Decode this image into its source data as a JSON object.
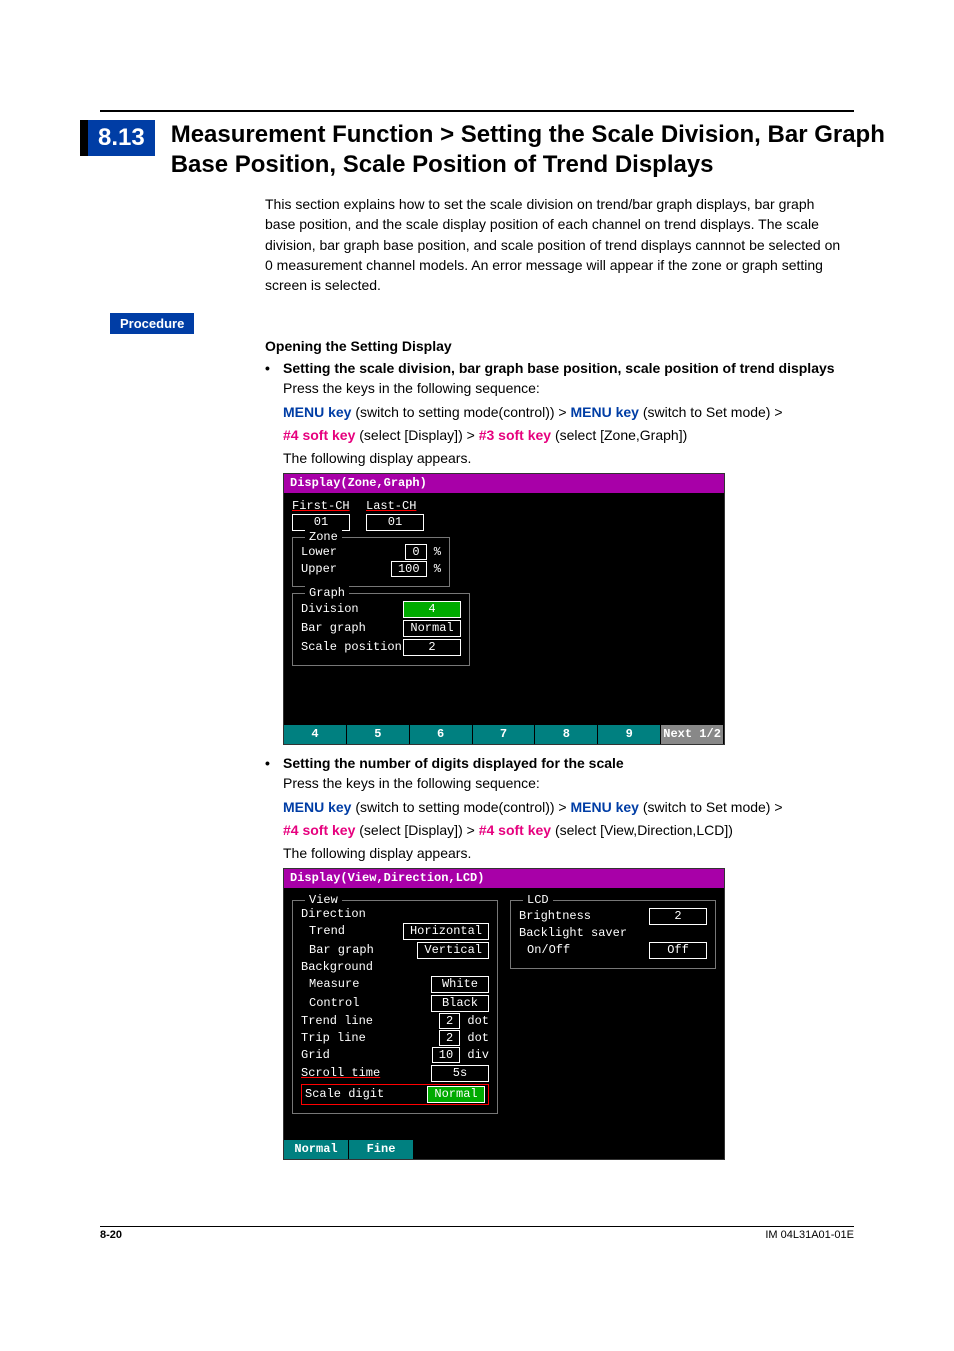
{
  "section_number": "8.13",
  "section_title": "Measurement Function > Setting the Scale Division, Bar Graph Base Position, Scale Position of Trend Displays",
  "intro": "This section explains how to set the scale division on trend/bar graph displays, bar graph base position, and the scale display position of each channel on trend displays. The scale division, bar graph base position, and scale position of trend displays cannnot be selected on 0 measurement channel models.  An error message will appear if the zone or graph setting screen is selected.",
  "procedure_label": "Procedure",
  "opening_heading": "Opening the Setting Display",
  "bullet1": "Setting the scale division, bar graph base position, scale position of trend displays",
  "press_keys": "Press the keys in the following sequence:",
  "key_menu": "MENU key",
  "key_menu_desc1": " (switch to setting mode(control)) > ",
  "key_menu_desc2": " (switch to Set mode) > ",
  "key_soft4": "#4 soft key",
  "key_soft4_desc1": " (select [Display]) > ",
  "key_soft3": "#3 soft key",
  "key_soft3_desc": " (select [Zone,Graph])",
  "following_display": "The following display appears.",
  "screen1": {
    "title": "Display(Zone,Graph)",
    "first_ch_label": "First-CH",
    "first_ch_val": "01",
    "last_ch_label": "Last-CH",
    "last_ch_val": "01",
    "zone_legend": "Zone",
    "lower_label": "Lower",
    "lower_val": "0",
    "lower_unit": "%",
    "upper_label": "Upper",
    "upper_val": "100",
    "upper_unit": "%",
    "graph_legend": "Graph",
    "division_label": "Division",
    "division_val": "4",
    "bargraph_label": "Bar graph",
    "bargraph_val": "Normal",
    "scalepos_label": "Scale position",
    "scalepos_val": "2",
    "softkeys": [
      "4",
      "5",
      "6",
      "7",
      "8",
      "9",
      "Next 1/2"
    ]
  },
  "bullet2": "Setting the number of digits displayed for the scale",
  "key_soft4_desc2": " (select [View,Direction,LCD])",
  "screen2": {
    "title": "Display(View,Direction,LCD)",
    "view_legend": "View",
    "direction_label": "Direction",
    "trend_label": "Trend",
    "trend_val": "Horizontal",
    "bargraph_label": "Bar graph",
    "bargraph_val": "Vertical",
    "background_label": "Background",
    "measure_label": "Measure",
    "measure_val": "White",
    "control_label": "Control",
    "control_val": "Black",
    "trendline_label": "Trend line",
    "trendline_val": "2",
    "trendline_unit": "dot",
    "tripline_label": "Trip line",
    "tripline_val": "2",
    "tripline_unit": "dot",
    "grid_label": "Grid",
    "grid_val": "10",
    "grid_unit": "div",
    "scrolltime_label": "Scroll time",
    "scrolltime_val": "5s",
    "scaledigit_label": "Scale digit",
    "scaledigit_val": "Normal",
    "lcd_legend": "LCD",
    "brightness_label": "Brightness",
    "brightness_val": "2",
    "backlight_label": "Backlight saver",
    "onoff_label": "On/Off",
    "onoff_val": "Off",
    "softkeys": [
      "Normal",
      "Fine"
    ]
  },
  "page_number": "8-20",
  "doc_code": "IM 04L31A01-01E"
}
